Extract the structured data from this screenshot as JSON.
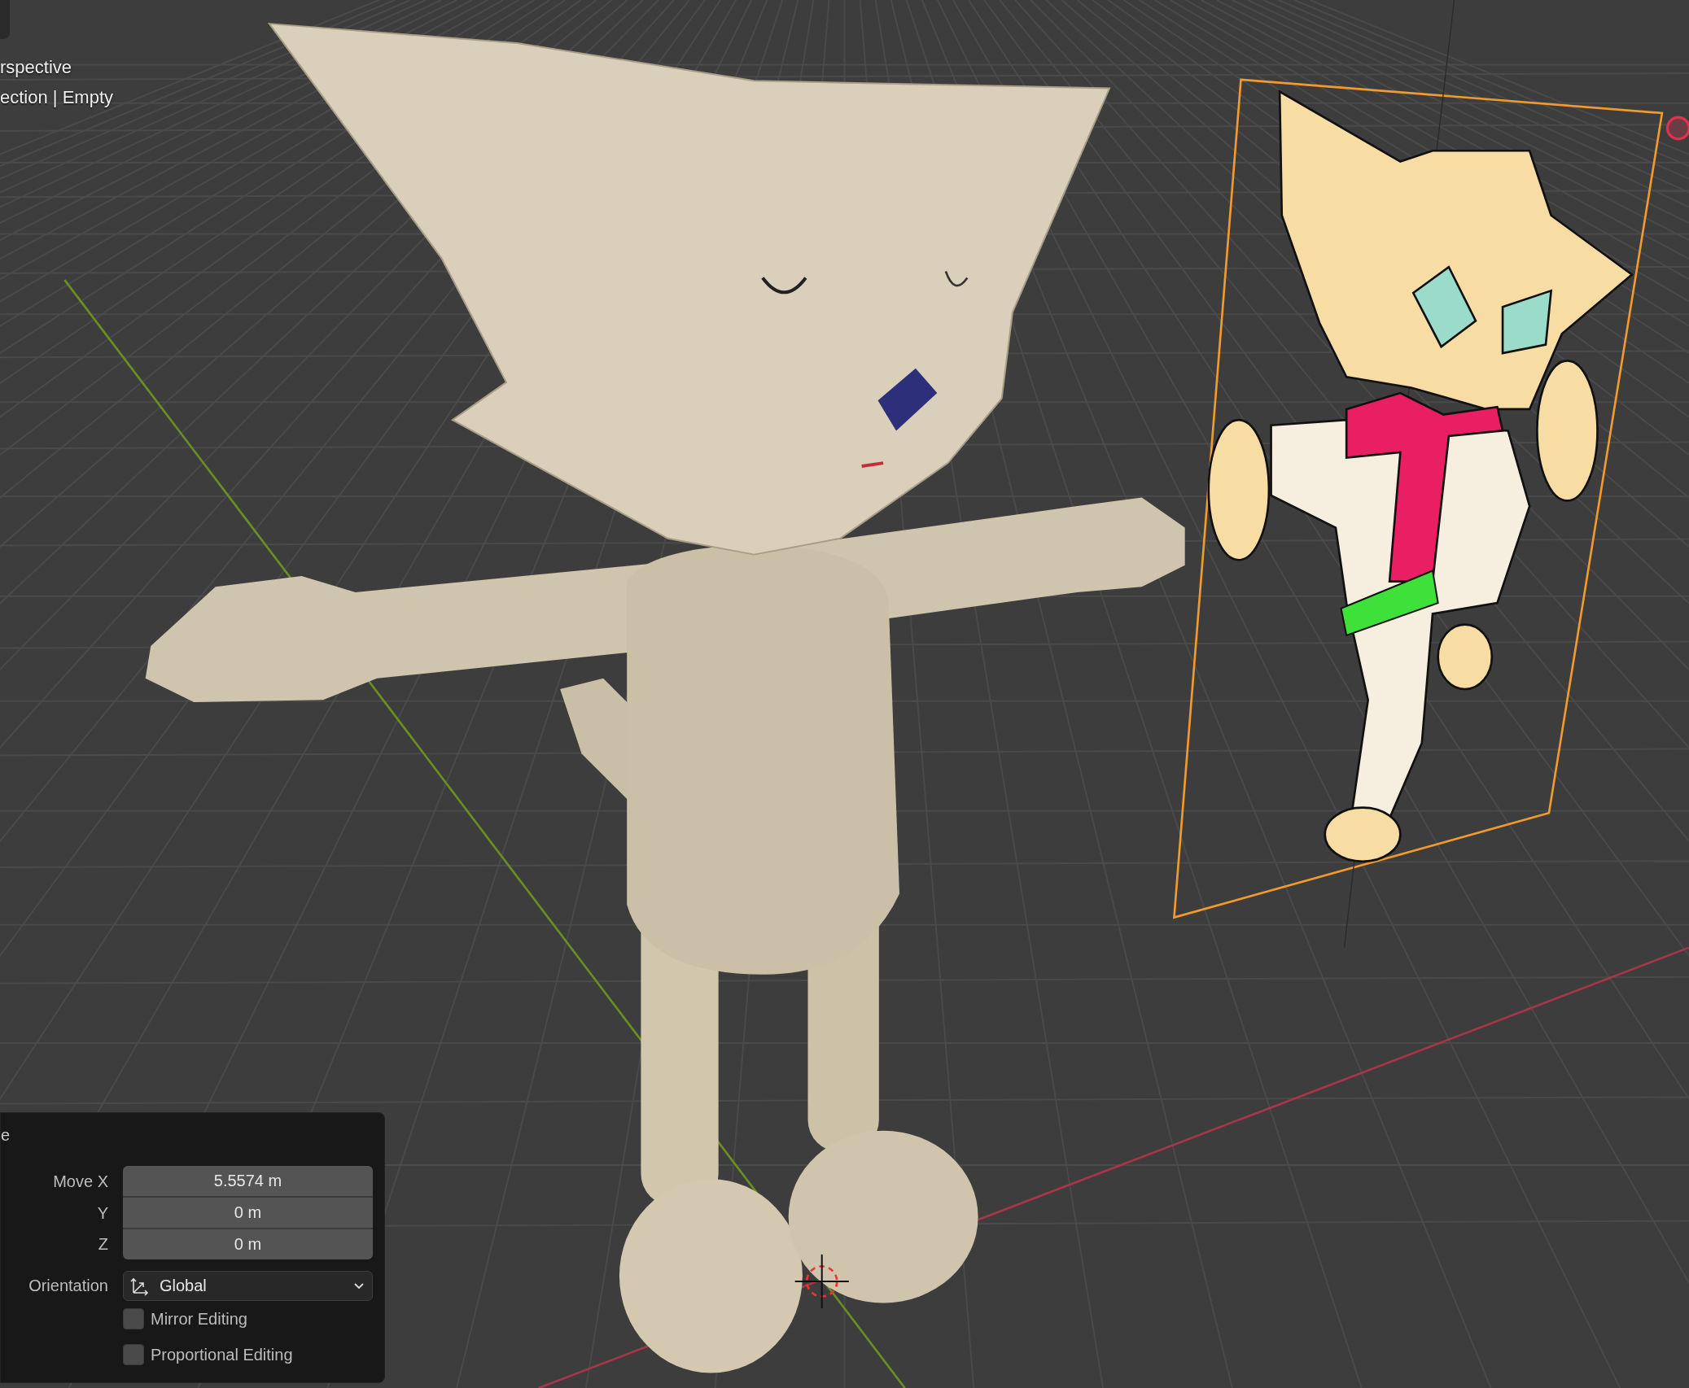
{
  "viewport": {
    "overlay_lines": [
      "rspective",
      "ection | Empty"
    ]
  },
  "operator_panel": {
    "title": "e",
    "fields": [
      {
        "label": "Move X",
        "value": "5.5574 m"
      },
      {
        "label": "Y",
        "value": "0 m"
      },
      {
        "label": "Z",
        "value": "0 m"
      }
    ],
    "orientation": {
      "label": "Orientation",
      "value": "Global"
    },
    "options": [
      {
        "label": "Mirror Editing",
        "checked": false
      },
      {
        "label": "Proportional Editing",
        "checked": false
      }
    ]
  }
}
